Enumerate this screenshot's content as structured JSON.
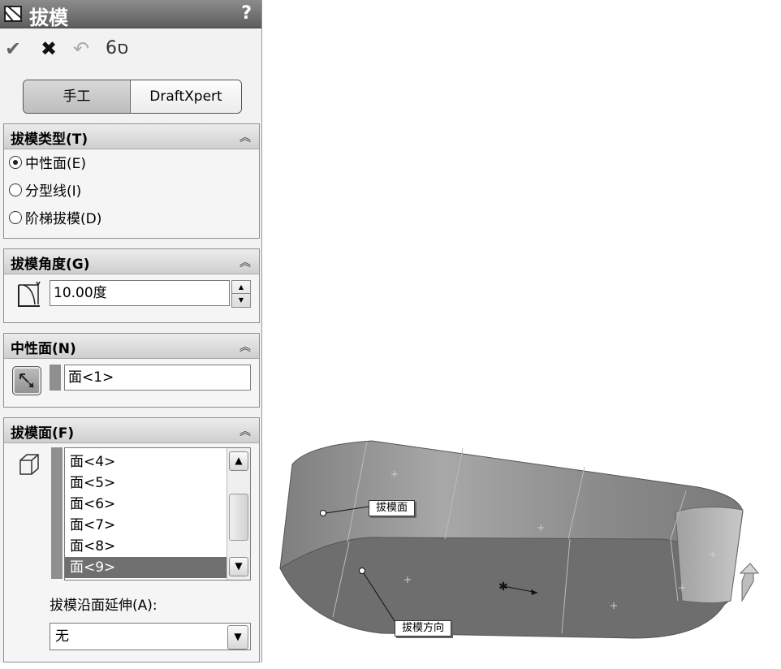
{
  "title": "拔模",
  "help": "?",
  "actions": [
    {
      "icon": "checkmark-icon",
      "glyph": "✔"
    },
    {
      "icon": "close-icon",
      "glyph": "✖"
    },
    {
      "icon": "undo-icon",
      "glyph": "↶"
    },
    {
      "icon": "glasses-icon",
      "glyph": "6ס"
    }
  ],
  "mode_toggle": {
    "manual": "手工",
    "expert": "DraftXpert"
  },
  "draft_type": {
    "title": "拔模类型(T)",
    "options": [
      {
        "label": "中性面(E)",
        "selected": true
      },
      {
        "label": "分型线(I)",
        "selected": false
      },
      {
        "label": "阶梯拔模(D)",
        "selected": false
      }
    ]
  },
  "draft_angle": {
    "title": "拔模角度(G)",
    "value": "10.00度"
  },
  "neutral_plane": {
    "title": "中性面(N)",
    "value": "面<1>"
  },
  "faces_to_draft": {
    "title": "拔模面(F)",
    "items": [
      "面<4>",
      "面<5>",
      "面<6>",
      "面<7>",
      "面<8>",
      "面<9>"
    ],
    "selected_index": 5,
    "propagation_label": "拔模沿面延伸(A):",
    "propagation_value": "无"
  },
  "viewport": {
    "callout_faces": "拔模面",
    "callout_direction": "拔模方向"
  },
  "colors": {
    "title_bar": "#6b6b6b",
    "selection": "#6f6f6f",
    "model_top": "#8c8c8c",
    "model_bottom": "#6a6a6a"
  }
}
